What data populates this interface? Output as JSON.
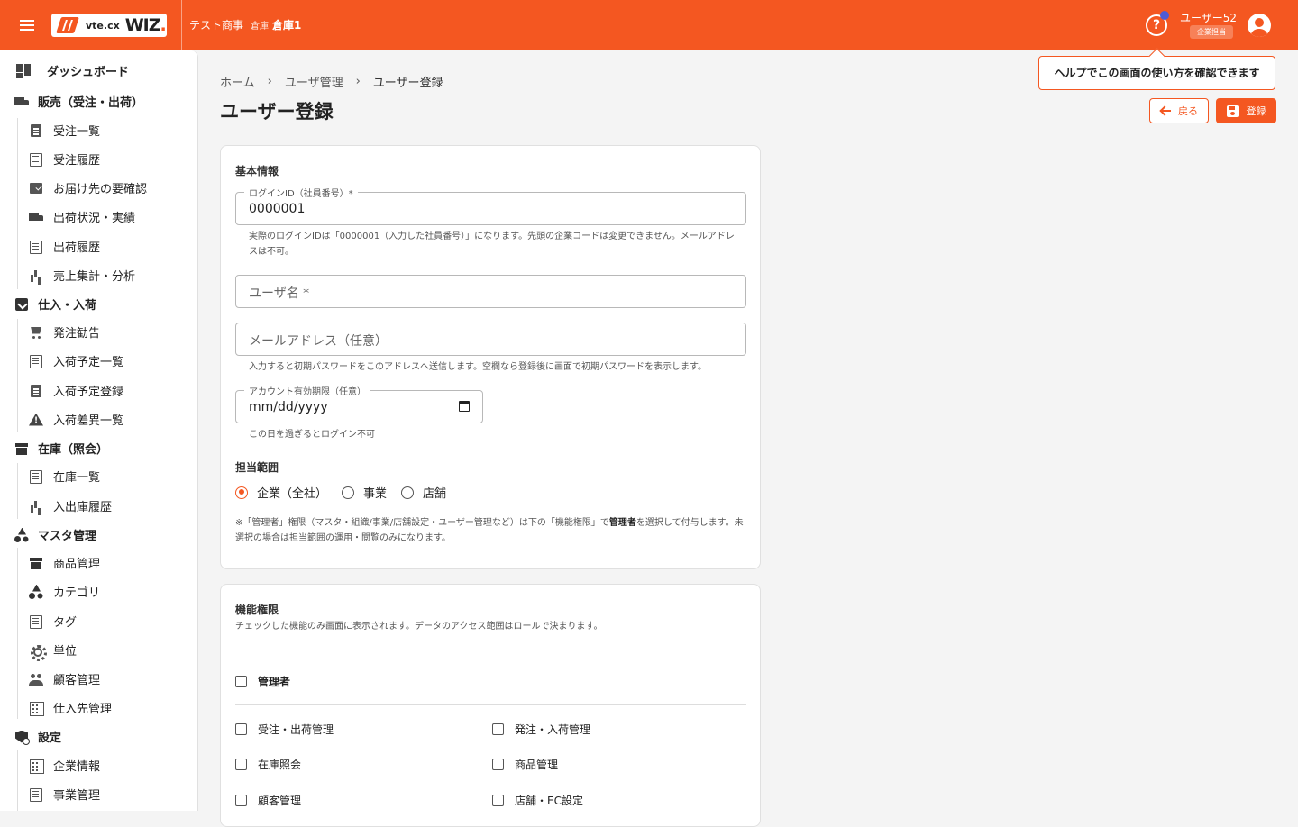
{
  "header": {
    "logo_vte": "vte.cx",
    "logo_wiz": "WIZ",
    "logo_dot": ".",
    "company": "テスト商事",
    "warehouse_label": "倉庫",
    "warehouse": "倉庫1",
    "help_glyph": "?",
    "user_name": "ユーザー52",
    "user_role": "企業担当",
    "brand_color": "#f45721"
  },
  "sidebar": {
    "items": [
      {
        "label": "ダッシュボード",
        "icon": "dashboard-icon"
      },
      {
        "label": "販売（受注・出荷）",
        "icon": "truck-icon"
      },
      {
        "label": "受注一覧",
        "icon": "clipboard-icon"
      },
      {
        "label": "受注履歴",
        "icon": "list-icon"
      },
      {
        "label": "お届け先の要確認",
        "icon": "checklist-icon"
      },
      {
        "label": "出荷状況・実績",
        "icon": "truck-icon"
      },
      {
        "label": "出荷履歴",
        "icon": "list-icon"
      },
      {
        "label": "売上集計・分析",
        "icon": "bar-chart-icon"
      },
      {
        "label": "仕入・入荷",
        "icon": "inbox-icon"
      },
      {
        "label": "発注勧告",
        "icon": "cart-icon"
      },
      {
        "label": "入荷予定一覧",
        "icon": "list-icon"
      },
      {
        "label": "入荷予定登録",
        "icon": "clipboard-icon"
      },
      {
        "label": "入荷差異一覧",
        "icon": "warning-icon"
      },
      {
        "label": "在庫（照会）",
        "icon": "archive-icon"
      },
      {
        "label": "在庫一覧",
        "icon": "list-icon"
      },
      {
        "label": "入出庫履歴",
        "icon": "bar-chart-icon"
      },
      {
        "label": "マスタ管理",
        "icon": "shapes-icon"
      },
      {
        "label": "商品管理",
        "icon": "archive-icon"
      },
      {
        "label": "カテゴリ",
        "icon": "shapes-icon"
      },
      {
        "label": "タグ",
        "icon": "list-icon"
      },
      {
        "label": "単位",
        "icon": "gear-icon"
      },
      {
        "label": "顧客管理",
        "icon": "people-icon"
      },
      {
        "label": "仕入先管理",
        "icon": "building-icon"
      },
      {
        "label": "設定",
        "icon": "settings-icon"
      },
      {
        "label": "企業情報",
        "icon": "building-icon"
      },
      {
        "label": "事業管理",
        "icon": "list-icon"
      }
    ]
  },
  "breadcrumb": {
    "items": [
      "ホーム",
      "ユーザ管理",
      "ユーザー登録"
    ],
    "separator": "›"
  },
  "page": {
    "title": "ユーザー登録",
    "help_tooltip": "ヘルプでこの画面の使い方を確認できます",
    "back_label": "戻る",
    "save_label": "登録"
  },
  "basic": {
    "title": "基本情報",
    "login_label": "ログインID（社員番号）*",
    "login_value": "0000001",
    "login_helper": "実際のログインIDは「0000001（入力した社員番号）」になります。先頭の企業コードは変更できません。メールアドレスは不可。",
    "username_placeholder": "ユーザ名 *",
    "email_placeholder": "メールアドレス（任意）",
    "email_helper": "入力すると初期パスワードをこのアドレスへ送信します。空欄なら登録後に画面で初期パスワードを表示します。",
    "expiry_label": "アカウント有効期限（任意）",
    "expiry_value": "mm/dd/yyyy",
    "expiry_helper": "この日を過ぎるとログイン不可",
    "scope_title": "担当範囲",
    "scope_options": [
      "企業（全社）",
      "事業",
      "店舗"
    ],
    "scope_selected": "企業（全社）",
    "note_pre": "※「管理者」権限（マスタ・組織/事業/店舗設定・ユーザー管理など）は下の「機能権限」で",
    "note_bold": "管理者",
    "note_post": "を選択して付与します。未選択の場合は担当範囲の運用・閲覧のみになります。"
  },
  "permissions": {
    "title": "機能権限",
    "description": "チェックした機能のみ画面に表示されます。データのアクセス範囲はロールで決まります。",
    "admin_label": "管理者",
    "items": [
      "受注・出荷管理",
      "発注・入荷管理",
      "在庫照会",
      "商品管理",
      "顧客管理",
      "店舗・EC設定"
    ]
  }
}
